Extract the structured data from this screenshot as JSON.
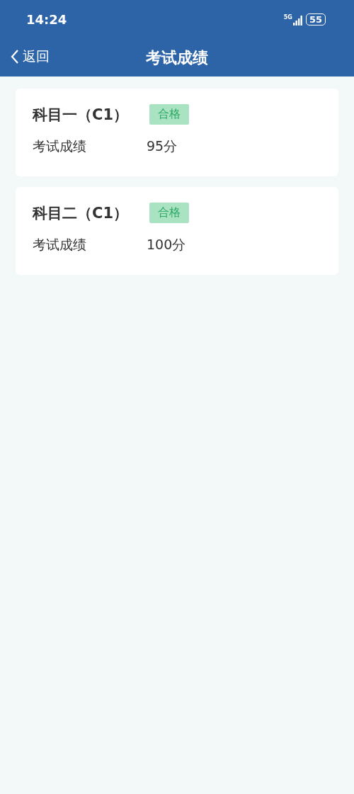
{
  "status_bar": {
    "time": "14:24",
    "network": "5G",
    "battery": "55"
  },
  "nav": {
    "back": "返回",
    "title": "考试成绩"
  },
  "results": [
    {
      "subject": "科目一（C1）",
      "badge": "合格",
      "label": "考试成绩",
      "score": "95分"
    },
    {
      "subject": "科目二（C1）",
      "badge": "合格",
      "label": "考试成绩",
      "score": "100分"
    }
  ]
}
